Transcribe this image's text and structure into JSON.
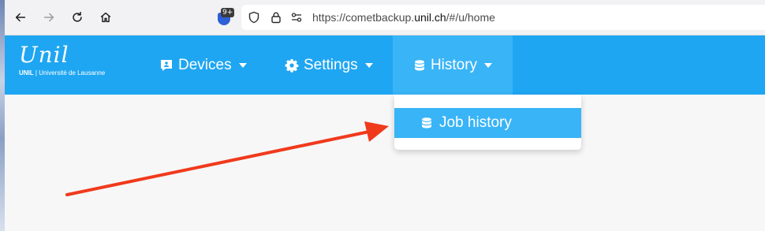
{
  "browser": {
    "url_prefix": "https://cometbackup.",
    "url_host": "unil.ch",
    "url_path": "/#/u/home",
    "extension_badge": "9+",
    "icons": [
      "back-icon",
      "forward-icon",
      "reload-icon",
      "home-icon",
      "extension-icon",
      "tracking-shield-icon",
      "lock-icon",
      "permissions-icon"
    ]
  },
  "brand": {
    "logo_script": "Unil",
    "logo_sub_bold": "UNIL",
    "logo_sub": " | Université de Lausanne"
  },
  "nav": {
    "devices": "Devices",
    "settings": "Settings",
    "history": "History"
  },
  "dropdown": {
    "job_history": "Job history"
  },
  "colors": {
    "navbar": "#1fa6f2",
    "active": "#39b4f6",
    "annotation_arrow": "#f03a1c"
  }
}
